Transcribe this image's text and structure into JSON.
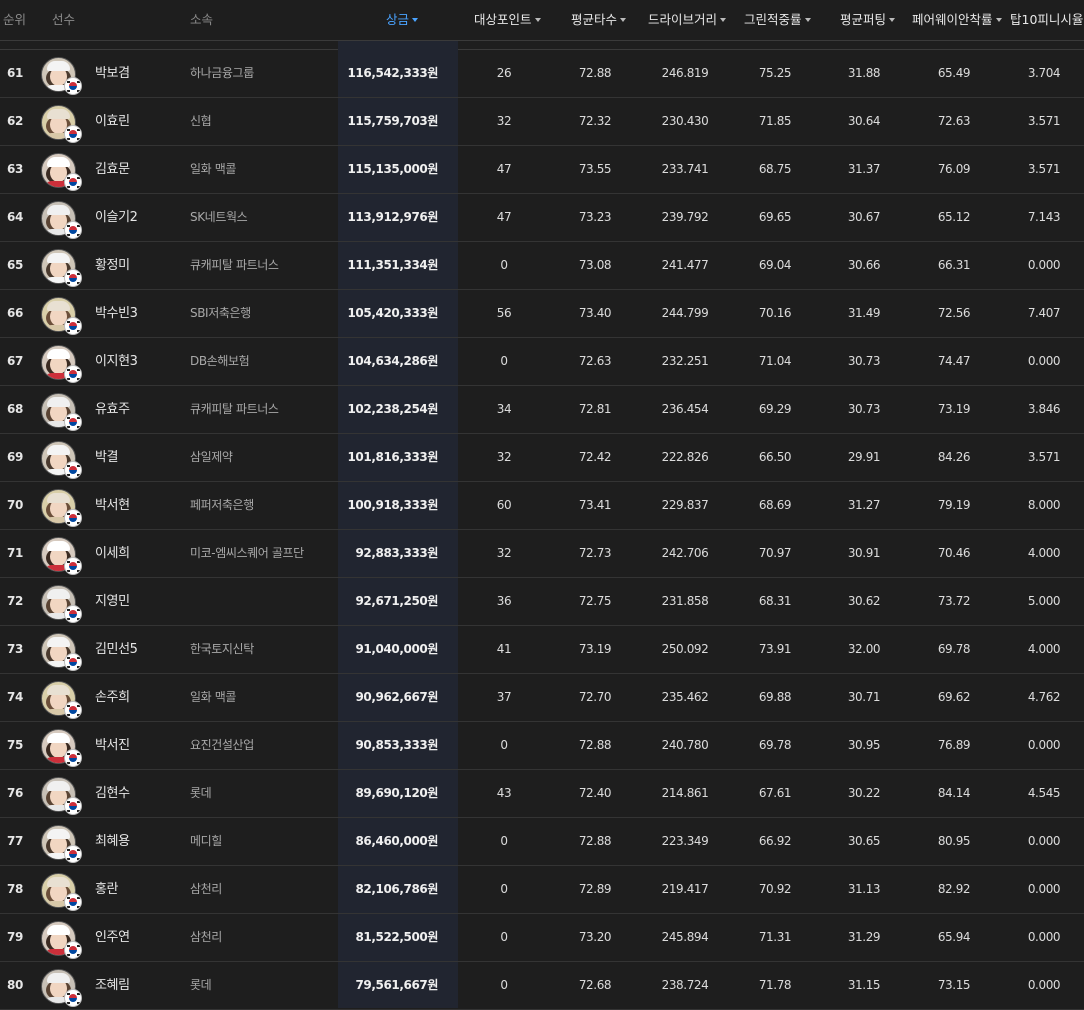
{
  "header": {
    "rank": "순위",
    "player": "선수",
    "team": "소속",
    "money": "상금",
    "points": "대상포인트",
    "avg_score": "평균타수",
    "drive": "드라이브거리",
    "gir": "그린적중률",
    "putting": "평균퍼팅",
    "fairway": "페어웨이안착률",
    "top10": "탑10피니시율"
  },
  "rows": [
    {
      "rank": "61",
      "name": "박보겸",
      "team": "하나금융그룹",
      "money": "116,542,333원",
      "points": "26",
      "avg": "72.88",
      "drive": "246.819",
      "gir": "75.25",
      "putt": "31.88",
      "fair": "65.49",
      "top10": "3.704"
    },
    {
      "rank": "62",
      "name": "이효린",
      "team": "신협",
      "money": "115,759,703원",
      "points": "32",
      "avg": "72.32",
      "drive": "230.430",
      "gir": "71.85",
      "putt": "30.64",
      "fair": "72.63",
      "top10": "3.571"
    },
    {
      "rank": "63",
      "name": "김효문",
      "team": "일화 맥콜",
      "money": "115,135,000원",
      "points": "47",
      "avg": "73.55",
      "drive": "233.741",
      "gir": "68.75",
      "putt": "31.37",
      "fair": "76.09",
      "top10": "3.571"
    },
    {
      "rank": "64",
      "name": "이슬기2",
      "team": "SK네트웍스",
      "money": "113,912,976원",
      "points": "47",
      "avg": "73.23",
      "drive": "239.792",
      "gir": "69.65",
      "putt": "30.67",
      "fair": "65.12",
      "top10": "7.143"
    },
    {
      "rank": "65",
      "name": "황정미",
      "team": "큐캐피탈 파트너스",
      "money": "111,351,334원",
      "points": "0",
      "avg": "73.08",
      "drive": "241.477",
      "gir": "69.04",
      "putt": "30.66",
      "fair": "66.31",
      "top10": "0.000"
    },
    {
      "rank": "66",
      "name": "박수빈3",
      "team": "SBI저축은행",
      "money": "105,420,333원",
      "points": "56",
      "avg": "73.40",
      "drive": "244.799",
      "gir": "70.16",
      "putt": "31.49",
      "fair": "72.56",
      "top10": "7.407"
    },
    {
      "rank": "67",
      "name": "이지현3",
      "team": "DB손해보험",
      "money": "104,634,286원",
      "points": "0",
      "avg": "72.63",
      "drive": "232.251",
      "gir": "71.04",
      "putt": "30.73",
      "fair": "74.47",
      "top10": "0.000"
    },
    {
      "rank": "68",
      "name": "유효주",
      "team": "큐캐피탈 파트너스",
      "money": "102,238,254원",
      "points": "34",
      "avg": "72.81",
      "drive": "236.454",
      "gir": "69.29",
      "putt": "30.73",
      "fair": "73.19",
      "top10": "3.846"
    },
    {
      "rank": "69",
      "name": "박결",
      "team": "삼일제약",
      "money": "101,816,333원",
      "points": "32",
      "avg": "72.42",
      "drive": "222.826",
      "gir": "66.50",
      "putt": "29.91",
      "fair": "84.26",
      "top10": "3.571"
    },
    {
      "rank": "70",
      "name": "박서현",
      "team": "페퍼저축은행",
      "money": "100,918,333원",
      "points": "60",
      "avg": "73.41",
      "drive": "229.837",
      "gir": "68.69",
      "putt": "31.27",
      "fair": "79.19",
      "top10": "8.000"
    },
    {
      "rank": "71",
      "name": "이세희",
      "team": "미코-엠씨스퀘어 골프단",
      "money": "92,883,333원",
      "points": "32",
      "avg": "72.73",
      "drive": "242.706",
      "gir": "70.97",
      "putt": "30.91",
      "fair": "70.46",
      "top10": "4.000"
    },
    {
      "rank": "72",
      "name": "지영민",
      "team": "",
      "money": "92,671,250원",
      "points": "36",
      "avg": "72.75",
      "drive": "231.858",
      "gir": "68.31",
      "putt": "30.62",
      "fair": "73.72",
      "top10": "5.000"
    },
    {
      "rank": "73",
      "name": "김민선5",
      "team": "한국토지신탁",
      "money": "91,040,000원",
      "points": "41",
      "avg": "73.19",
      "drive": "250.092",
      "gir": "73.91",
      "putt": "32.00",
      "fair": "69.78",
      "top10": "4.000"
    },
    {
      "rank": "74",
      "name": "손주희",
      "team": "일화 맥콜",
      "money": "90,962,667원",
      "points": "37",
      "avg": "72.70",
      "drive": "235.462",
      "gir": "69.88",
      "putt": "30.71",
      "fair": "69.62",
      "top10": "4.762"
    },
    {
      "rank": "75",
      "name": "박서진",
      "team": "요진건설산업",
      "money": "90,853,333원",
      "points": "0",
      "avg": "72.88",
      "drive": "240.780",
      "gir": "69.78",
      "putt": "30.95",
      "fair": "76.89",
      "top10": "0.000"
    },
    {
      "rank": "76",
      "name": "김현수",
      "team": "롯데",
      "money": "89,690,120원",
      "points": "43",
      "avg": "72.40",
      "drive": "214.861",
      "gir": "67.61",
      "putt": "30.22",
      "fair": "84.14",
      "top10": "4.545"
    },
    {
      "rank": "77",
      "name": "최혜용",
      "team": "메디힐",
      "money": "86,460,000원",
      "points": "0",
      "avg": "72.88",
      "drive": "223.349",
      "gir": "66.92",
      "putt": "30.65",
      "fair": "80.95",
      "top10": "0.000"
    },
    {
      "rank": "78",
      "name": "홍란",
      "team": "삼천리",
      "money": "82,106,786원",
      "points": "0",
      "avg": "72.89",
      "drive": "219.417",
      "gir": "70.92",
      "putt": "31.13",
      "fair": "82.92",
      "top10": "0.000"
    },
    {
      "rank": "79",
      "name": "인주연",
      "team": "삼천리",
      "money": "81,522,500원",
      "points": "0",
      "avg": "73.20",
      "drive": "245.894",
      "gir": "71.31",
      "putt": "31.29",
      "fair": "65.94",
      "top10": "0.000"
    },
    {
      "rank": "80",
      "name": "조혜림",
      "team": "롯데",
      "money": "79,561,667원",
      "points": "0",
      "avg": "72.68",
      "drive": "238.724",
      "gir": "71.78",
      "putt": "31.15",
      "fair": "73.15",
      "top10": "0.000"
    }
  ],
  "colors": {
    "background": "#1e1e1e",
    "active_sort": "#4aa3ff",
    "money_column_bg": "#212530"
  }
}
